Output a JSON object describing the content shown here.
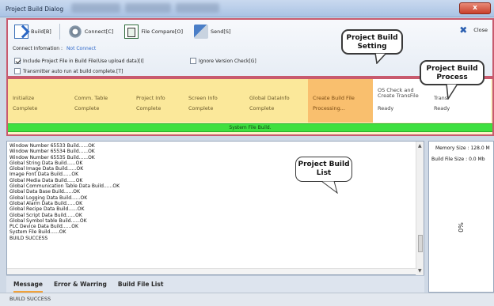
{
  "window": {
    "title": "Project Build Dialog",
    "close_glyph": "x"
  },
  "toolbar": {
    "build_label": "Build[B]",
    "connect_label": "Connect[C]",
    "compare_label": "File Compare[O]",
    "send_label": "Send[S]",
    "close_label": "Close"
  },
  "connection": {
    "label": "Connect Infomation :",
    "value": "Not Connect"
  },
  "options": {
    "include_project": {
      "label": "Include Project File in Build File(Use upload data)[I]",
      "checked": true
    },
    "ignore_version": {
      "label": "Ignore Version Check[G]",
      "checked": false
    },
    "auto_run": {
      "label": "Transmitter auto run at build complete.[T]",
      "checked": false
    }
  },
  "steps": [
    {
      "name": "Initialize",
      "status": "Complete",
      "state": "done"
    },
    {
      "name": "Comm. Table",
      "status": "Complete",
      "state": "done"
    },
    {
      "name": "Project Info",
      "status": "Complete",
      "state": "done"
    },
    {
      "name": "Screen Info",
      "status": "Complete",
      "state": "done"
    },
    {
      "name": "Global DataInfo",
      "status": "Complete",
      "state": "done"
    },
    {
      "name": "Create Build File",
      "status": "Processing...",
      "state": "active"
    },
    {
      "name": "OS Check and Create TransFile",
      "status": "Ready",
      "state": "ready"
    },
    {
      "name": "Trans",
      "status": "Ready",
      "state": "ready"
    }
  ],
  "progress": {
    "label": "System File Build.",
    "fraction": 1.0
  },
  "log": [
    "Window Number 65533 Build......OK",
    "Window Number 65534 Build......OK",
    "Window Number 65535 Build......OK",
    "Global String Data Build......OK",
    "Global Image Data Build......OK",
    "Image Font Data Build......OK",
    "Global Media Data Build......OK",
    "Global Communication Table Data Build......OK",
    "Global Data Base Build......OK",
    "Global Logging Data Build......OK",
    "Global Alarm Data Build......OK",
    "Global Recipe Data Build......OK",
    "Global Script Data Build......OK",
    "Global Symbol table Build......OK",
    "PLC Device Data Build......OK",
    "System File Build......OK",
    "BUILD SUCCESS"
  ],
  "tabs": [
    "Message",
    "Error & Warring",
    "Build File List"
  ],
  "status_text": "BUILD SUCCESS",
  "side": {
    "memory": "Memory Size : 128.0 M",
    "build_size": "Build File Size : 0.0 Mb",
    "percent": "0%"
  },
  "callouts": {
    "setting": "Project Build\nSetting",
    "process": "Project Build\nProcess",
    "list": "Project Build\nList"
  }
}
